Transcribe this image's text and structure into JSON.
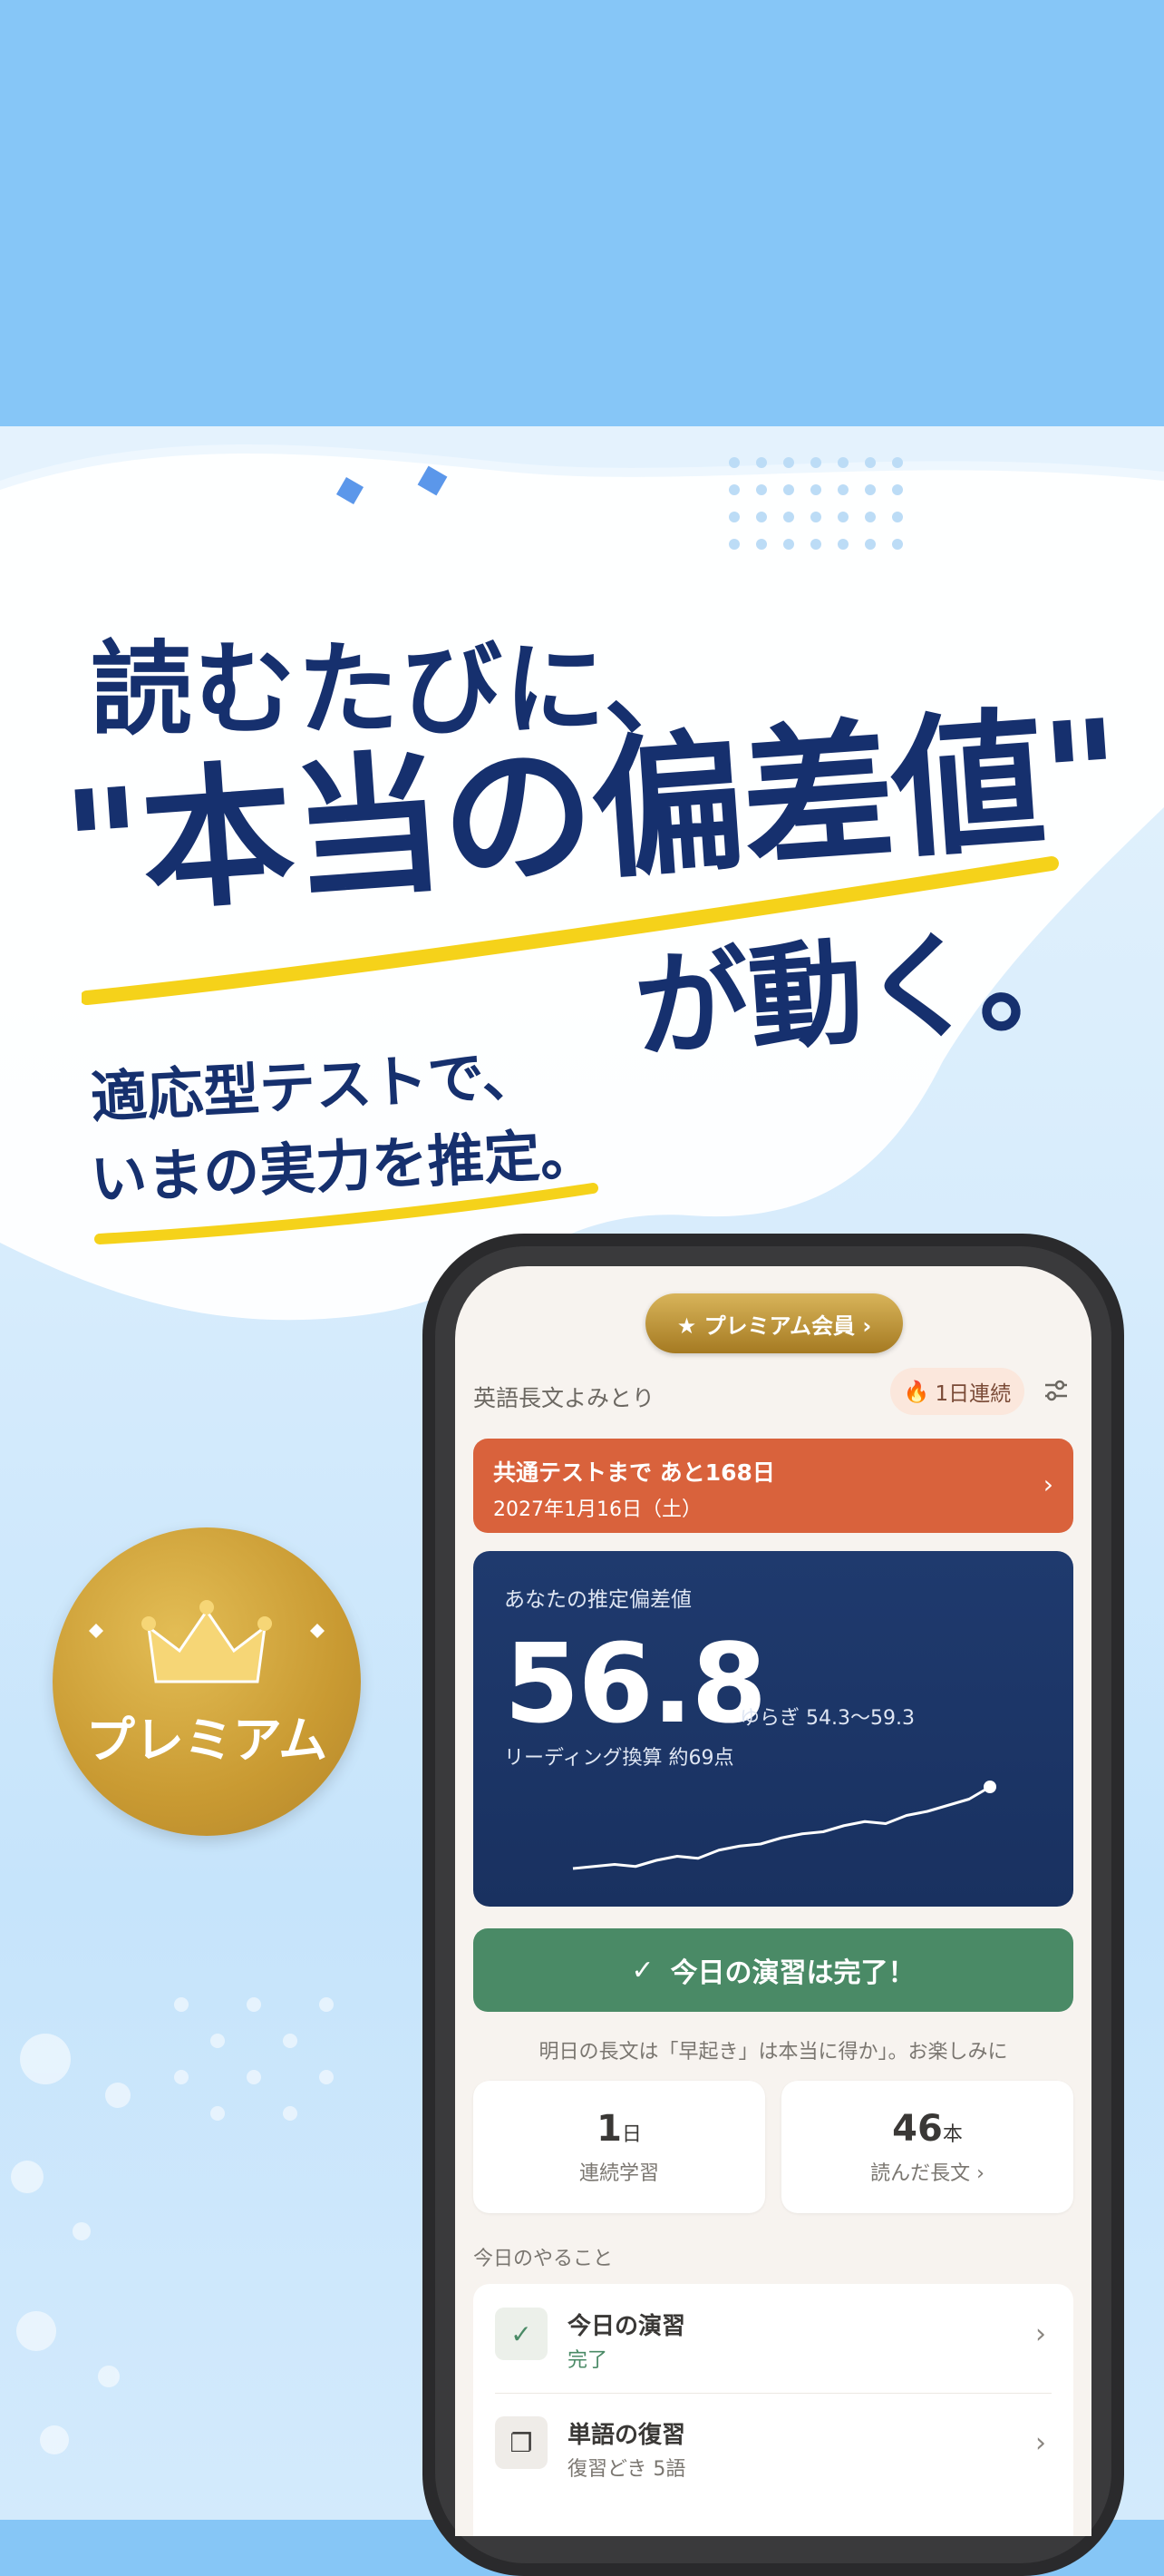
{
  "hero": {
    "line1": "読むたびに、",
    "line2": "\"本当の偏差値\"",
    "line3": "が動く。",
    "sub1": "適応型テストで、",
    "sub2": "いまの実力を推定。"
  },
  "badge": {
    "label": "プレミアム"
  },
  "app": {
    "premium_pill": "★ プレミアム会員 ›",
    "title": "英語長文よみとり",
    "streak": "1日連続",
    "exam_title": "共通テストまで あと168日",
    "exam_date": "2027年1月16日（土）",
    "score_label": "あなたの推定偏差値",
    "score_value": "56.8",
    "score_range": "ゆらぎ 54.3〜59.3",
    "score_conversion": "リーディング換算 約69点",
    "done_label": "今日の演習は完了！",
    "tomorrow": "明日の長文は「早起き」は本当に得か」。お楽しみに",
    "stats": [
      {
        "value": "1",
        "unit": "日",
        "label": "連続学習"
      },
      {
        "value": "46",
        "unit": "本",
        "label": "読んだ長文 ›"
      }
    ],
    "section_title": "今日のやること",
    "todos": [
      {
        "title": "今日の演習",
        "sub": "完了",
        "sub_color": "#4a8a66"
      },
      {
        "title": "単語の復習",
        "sub": "復習どき 5語",
        "sub_color": "#7a7670"
      }
    ]
  },
  "trend_values": [
    52.8,
    52.9,
    53.0,
    52.9,
    53.2,
    53.4,
    53.3,
    53.7,
    53.9,
    54.0,
    54.3,
    54.5,
    54.6,
    54.9,
    55.1,
    55.0,
    55.4,
    55.6,
    55.9,
    56.2,
    56.8
  ],
  "colors": {
    "navy": "#16306e",
    "accent_yellow": "#f5d21a",
    "exam_orange": "#d9623c",
    "score_navy": "#1f3a6e",
    "done_green": "#4a8a66",
    "gold": "#c99a32"
  }
}
